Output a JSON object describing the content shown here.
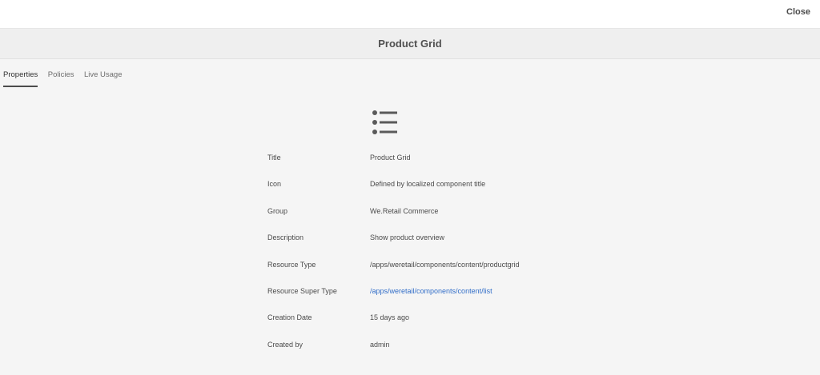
{
  "topbar": {
    "close_label": "Close"
  },
  "header": {
    "title": "Product Grid"
  },
  "tabs": [
    {
      "label": "Properties",
      "active": true
    },
    {
      "label": "Policies",
      "active": false
    },
    {
      "label": "Live Usage",
      "active": false
    }
  ],
  "component_icon": "list-icon",
  "properties": {
    "title": {
      "label": "Title",
      "value": "Product Grid"
    },
    "icon": {
      "label": "Icon",
      "value": "Defined by localized component title"
    },
    "group": {
      "label": "Group",
      "value": "We.Retail Commerce"
    },
    "description": {
      "label": "Description",
      "value": "Show product overview"
    },
    "resource_type": {
      "label": "Resource Type",
      "value": "/apps/weretail/components/content/productgrid"
    },
    "resource_super_type": {
      "label": "Resource Super Type",
      "value": "/apps/weretail/components/content/list"
    },
    "creation_date": {
      "label": "Creation Date",
      "value": "15 days ago"
    },
    "created_by": {
      "label": "Created by",
      "value": "admin"
    }
  },
  "colors": {
    "link": "#326ec8",
    "text": "#4b4b4b",
    "background": "#f5f5f5"
  }
}
